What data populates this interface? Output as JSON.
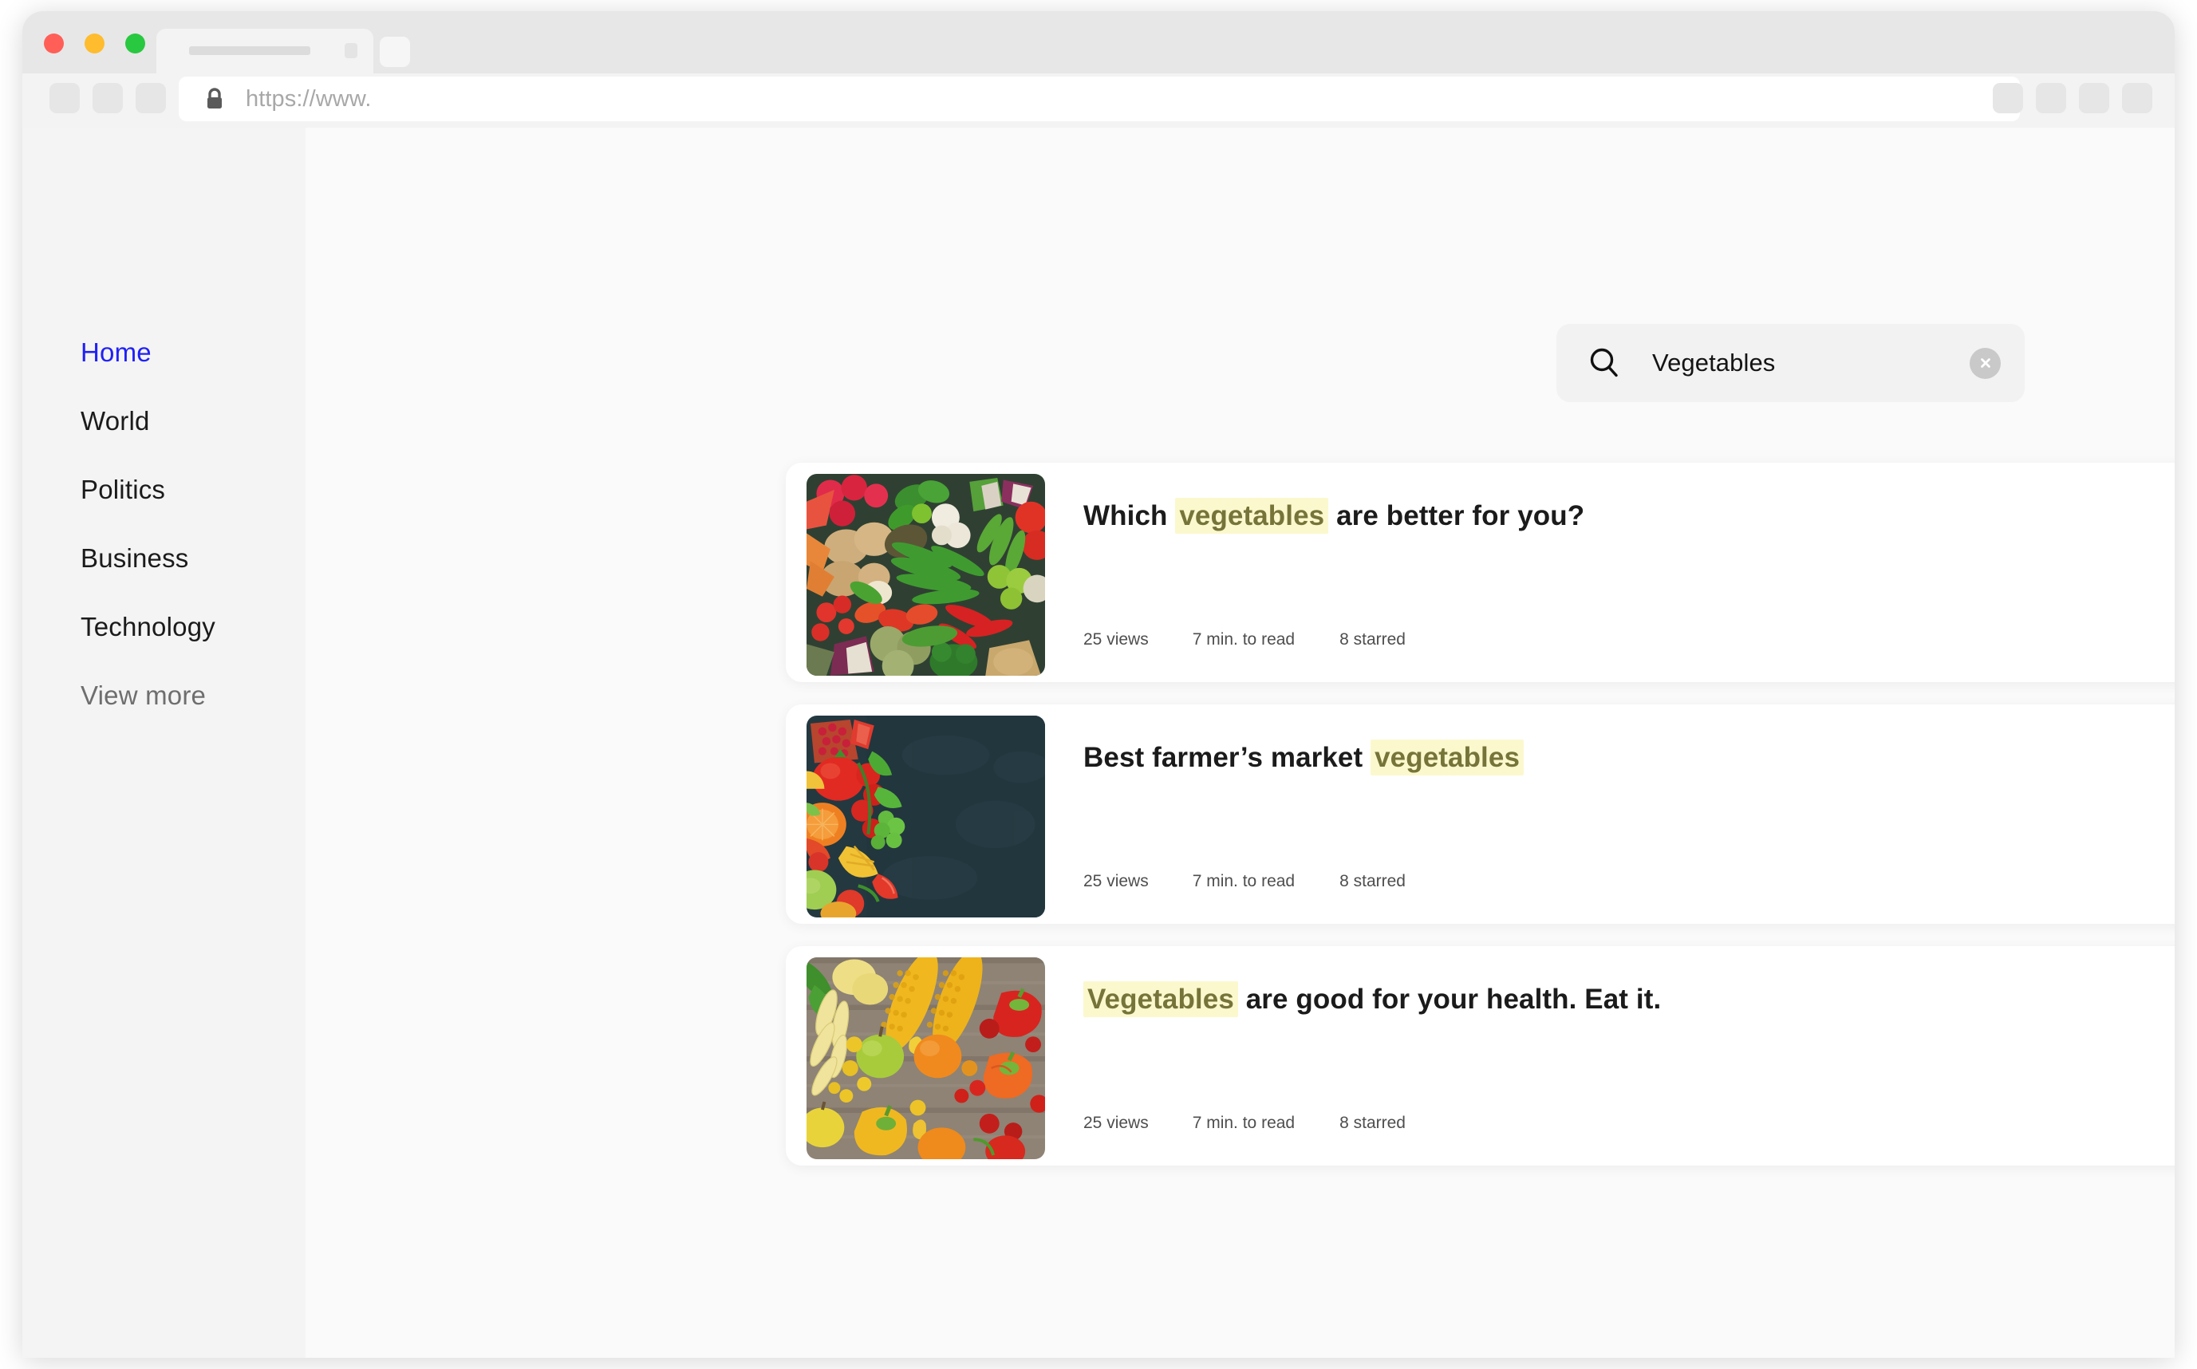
{
  "browser": {
    "traffic_lights": [
      "close",
      "minimize",
      "maximize"
    ],
    "url_placeholder": "https://www.",
    "lock_icon": "lock-icon",
    "tab_count": 1
  },
  "sidebar": {
    "items": [
      {
        "label": "Home",
        "state": "active"
      },
      {
        "label": "World",
        "state": "default"
      },
      {
        "label": "Politics",
        "state": "default"
      },
      {
        "label": "Business",
        "state": "default"
      },
      {
        "label": "Technology",
        "state": "default"
      },
      {
        "label": "View more",
        "state": "muted"
      }
    ]
  },
  "search": {
    "value": "Vegetables",
    "icon": "search-icon",
    "clear_icon": "close-circle-icon"
  },
  "results": [
    {
      "title_before": "Which ",
      "title_highlight": "vegetables",
      "title_after": " are better for you?",
      "views": "25 views",
      "read_time": "7 min. to read",
      "starred": "8 starred",
      "thumbnail": "assorted-fresh-vegetables-flatlay"
    },
    {
      "title_before": "Best farmer’s market ",
      "title_highlight": "vegetables",
      "title_after": "",
      "views": "25 views",
      "read_time": "7 min. to read",
      "starred": "8 starred",
      "thumbnail": "fruits-vegetables-on-dark-slate"
    },
    {
      "title_before": "",
      "title_highlight": "Vegetables",
      "title_after": " are good for your health. Eat it.",
      "views": "25 views",
      "read_time": "7 min. to read",
      "starred": "8 starred",
      "thumbnail": "corn-peppers-apples-on-wood"
    }
  ],
  "colors": {
    "accent": "#2121f5",
    "highlight_bg": "#fbf8cd",
    "highlight_text": "#77743a",
    "sidebar_bg": "#f4f4f4",
    "page_bg": "#fafafa",
    "card_bg": "#ffffff"
  }
}
